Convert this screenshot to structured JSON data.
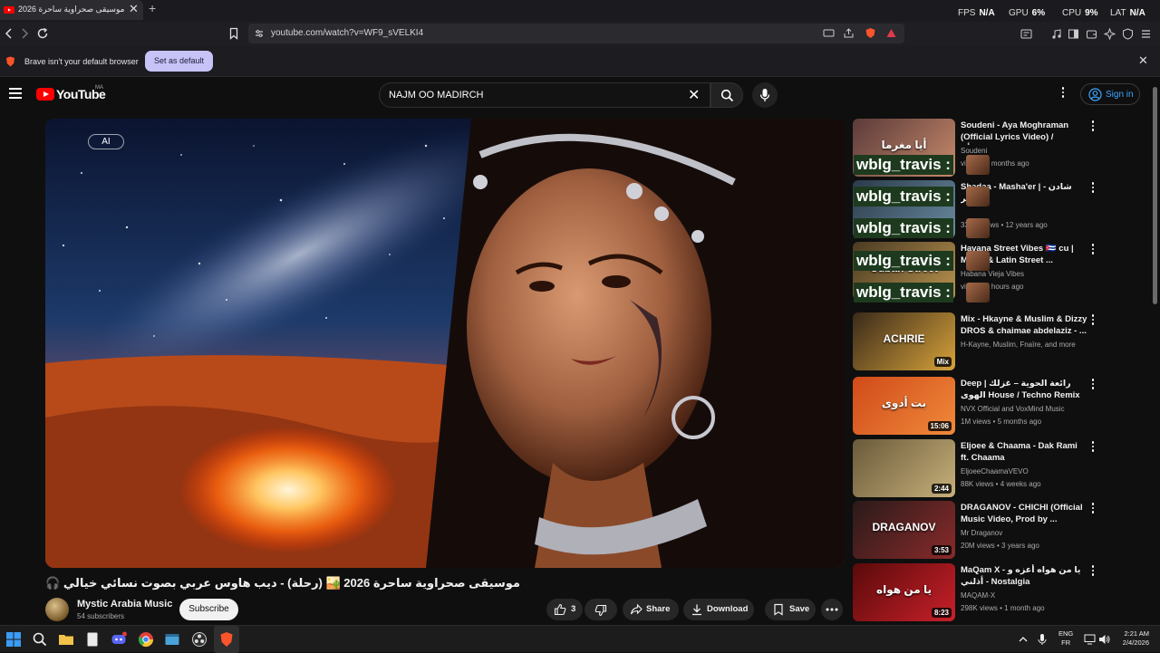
{
  "browser": {
    "tab_title": "موسيقى صحراوية ساحرة 2026",
    "new_tab": "+",
    "close": "✕",
    "perf": [
      {
        "label": "FPS",
        "value": "N/A"
      },
      {
        "label": "GPU",
        "value": "6%"
      },
      {
        "label": "CPU",
        "value": "9%"
      },
      {
        "label": "LAT",
        "value": "N/A"
      }
    ],
    "url": "youtube.com/watch?v=WF9_sVELKI4",
    "infobar_text": "Brave isn't your default browser",
    "set_default": "Set as default"
  },
  "youtube": {
    "logo_text": "YouTube",
    "country": "MA",
    "search_value": "NAJM OO MADIRCH",
    "sign_in": "Sign in"
  },
  "video": {
    "ai_badge": "AI",
    "title": "🎧 موسيقى صحراوية ساحرة 2026 🏜️ (رحلة) - ديب هاوس عربي بصوت نسائي خيالي",
    "channel": "Mystic Arabia Music",
    "subscribers": "54 subscribers",
    "subscribe": "Subscribe",
    "likes": "3",
    "share": "Share",
    "download": "Download",
    "save": "Save"
  },
  "sidebar": [
    {
      "title": "Soudeni - Aya Moghraman (Official Lyrics Video) / سوداني - أيا",
      "channel": "Soudeni",
      "meta": "views • 2 months ago",
      "duration": "",
      "colors": [
        "#5a3a3a",
        "#c98b6b"
      ]
    },
    {
      "title": "Shadaa - Masha'er | شادن - مشاعر",
      "channel": "",
      "meta": "339M views • 12 years ago",
      "duration": "",
      "colors": [
        "#2a3b4a",
        "#6a8aa0"
      ]
    },
    {
      "title": "Havana Street Vibes 🇨🇺 cu | Music & Latin Street ...",
      "channel": "Habana Vieja Vibes",
      "meta": "views • 6 hours ago",
      "duration": "",
      "colors": [
        "#4a3a22",
        "#b8934f"
      ]
    },
    {
      "title": "Mix - Hkayne & Muslim & Dizzy DROS & chaimae abdelaziz - ...",
      "channel": "H-Kayne, Muslim, Fnaïre, and more",
      "meta": "",
      "duration": "Mix",
      "colors": [
        "#3a2a1a",
        "#d6a23a"
      ]
    },
    {
      "title": "Deep | رائعة الحوية – غزلك الهوى House / Techno Remix 2025 | ...",
      "channel": "NVX Official and VoxMind Music",
      "meta": "1M views • 5 months ago",
      "duration": "15:06",
      "colors": [
        "#d04a1a",
        "#f08a3a"
      ]
    },
    {
      "title": "Eljoee & Chaama - Dak Rami ft. Chaama",
      "channel": "EljoeeChaamaVEVO",
      "meta": "88K views • 4 weeks ago",
      "duration": "2:44",
      "colors": [
        "#6a5a3a",
        "#c7b07a"
      ]
    },
    {
      "title": "DRAGANOV - CHICHI (Official Music Video, Prod by ...",
      "channel": "Mr Draganov",
      "meta": "20M views • 3 years ago",
      "duration": "3:53",
      "colors": [
        "#2a1a1a",
        "#8a2a2a"
      ]
    },
    {
      "title": "MaQam X - يا من هواه أعزه و أذلني - Nostalgia",
      "channel": "MAQAM-X",
      "meta": "298K views • 1 month ago",
      "duration": "8:23",
      "colors": [
        "#5a0a0a",
        "#c8202a"
      ]
    }
  ],
  "overlay_tag": "wblg_travis :",
  "thumb_text_1": "أيا مغرما",
  "thumb_text_3": "Cuban Street",
  "thumb_text_4": "ACHRIE",
  "thumb_text_5": "بت أدوى",
  "thumb_text_7": "DRAGANOV",
  "thumb_text_8": "يا من هواه",
  "taskbar": {
    "lang_1": "ENG",
    "lang_2": "FR",
    "time": "2:21 AM",
    "date": "2/4/2026"
  }
}
